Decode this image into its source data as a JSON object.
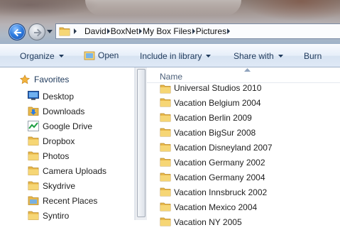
{
  "address": {
    "crumbs": [
      "David",
      "BoxNet",
      "My Box Files",
      "Pictures"
    ]
  },
  "toolbar": {
    "organize": "Organize",
    "open": "Open",
    "include_in_library": "Include in library",
    "share_with": "Share with",
    "burn": "Burn"
  },
  "nav": {
    "favorites": "Favorites",
    "items": [
      {
        "label": "Desktop",
        "icon": "desktop-icon"
      },
      {
        "label": "Downloads",
        "icon": "downloads-folder-icon"
      },
      {
        "label": "Google Drive",
        "icon": "google-drive-icon"
      },
      {
        "label": "Dropbox",
        "icon": "folder-icon"
      },
      {
        "label": "Photos",
        "icon": "folder-icon"
      },
      {
        "label": "Camera Uploads",
        "icon": "folder-icon"
      },
      {
        "label": "Skydrive",
        "icon": "folder-icon"
      },
      {
        "label": "Recent Places",
        "icon": "recent-places-icon"
      },
      {
        "label": "Syntiro",
        "icon": "folder-icon"
      }
    ]
  },
  "files": {
    "column_name": "Name",
    "items": [
      "Universal Studios 2010",
      "Vacation Belgium 2004",
      "Vacation Berlin 2009",
      "Vacation BigSur 2008",
      "Vacation Disneyland 2007",
      "Vacation Germany 2002",
      "Vacation Germany 2004",
      "Vacation Innsbruck 2002",
      "Vacation Mexico 2004",
      "Vacation NY 2005"
    ]
  },
  "colors": {
    "command_text": "#1e395b",
    "header_text": "#4c607a",
    "folder": "#f2c54e"
  }
}
